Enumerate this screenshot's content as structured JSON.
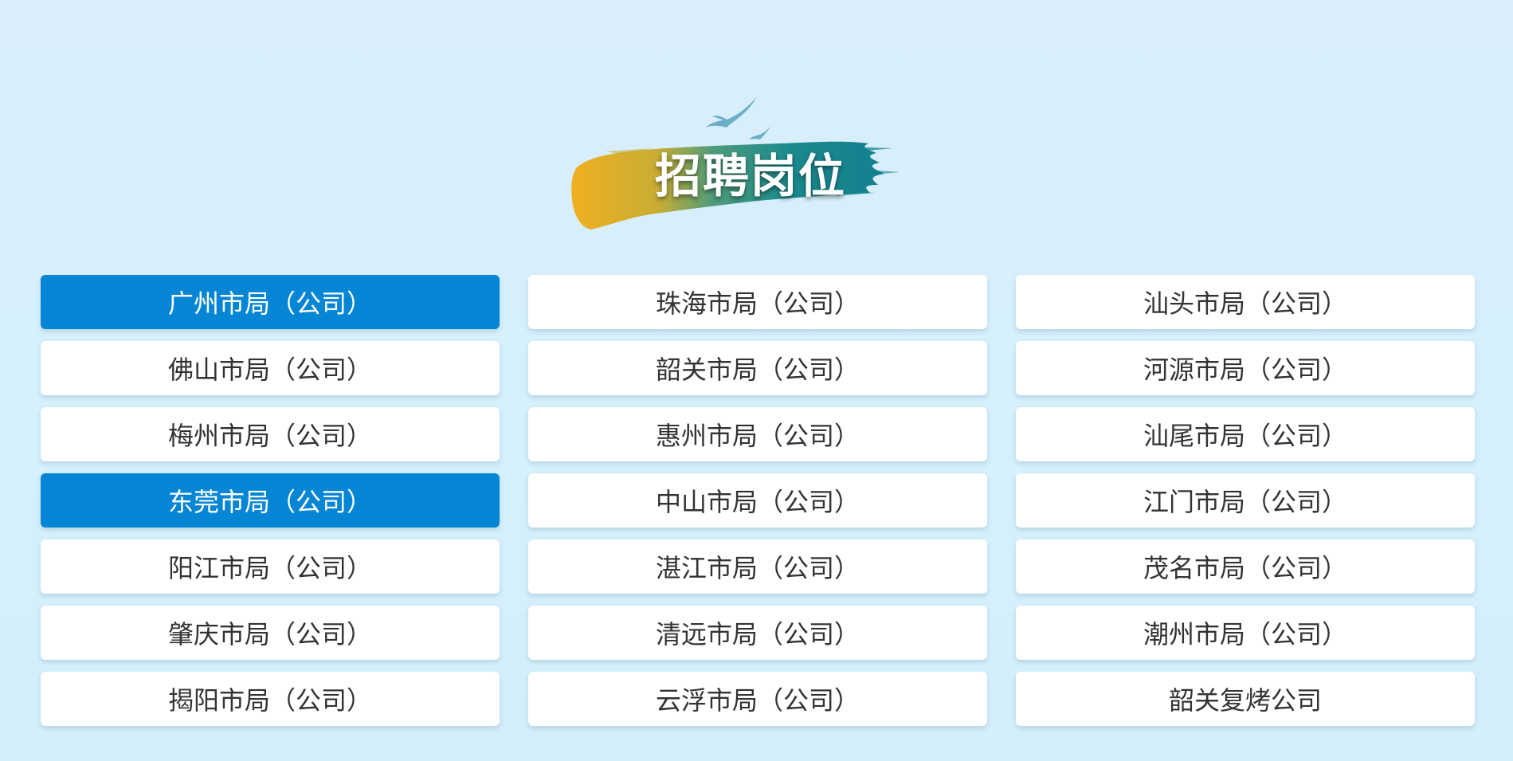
{
  "header": {
    "title": "招聘岗位"
  },
  "colors": {
    "background": "#d6f0fc",
    "active": "#0586d4",
    "card": "#ffffff",
    "text": "#333333"
  },
  "branches": [
    {
      "label": "广州市局（公司）",
      "active": true
    },
    {
      "label": "珠海市局（公司）",
      "active": false
    },
    {
      "label": "汕头市局（公司）",
      "active": false
    },
    {
      "label": "佛山市局（公司）",
      "active": false
    },
    {
      "label": "韶关市局（公司）",
      "active": false
    },
    {
      "label": "河源市局（公司）",
      "active": false
    },
    {
      "label": "梅州市局（公司）",
      "active": false
    },
    {
      "label": "惠州市局（公司）",
      "active": false
    },
    {
      "label": "汕尾市局（公司）",
      "active": false
    },
    {
      "label": "东莞市局（公司）",
      "active": true
    },
    {
      "label": "中山市局（公司）",
      "active": false
    },
    {
      "label": "江门市局（公司）",
      "active": false
    },
    {
      "label": "阳江市局（公司）",
      "active": false
    },
    {
      "label": "湛江市局（公司）",
      "active": false
    },
    {
      "label": "茂名市局（公司）",
      "active": false
    },
    {
      "label": "肇庆市局（公司）",
      "active": false
    },
    {
      "label": "清远市局（公司）",
      "active": false
    },
    {
      "label": "潮州市局（公司）",
      "active": false
    },
    {
      "label": "揭阳市局（公司）",
      "active": false
    },
    {
      "label": "云浮市局（公司）",
      "active": false
    },
    {
      "label": "韶关复烤公司",
      "active": false
    }
  ]
}
